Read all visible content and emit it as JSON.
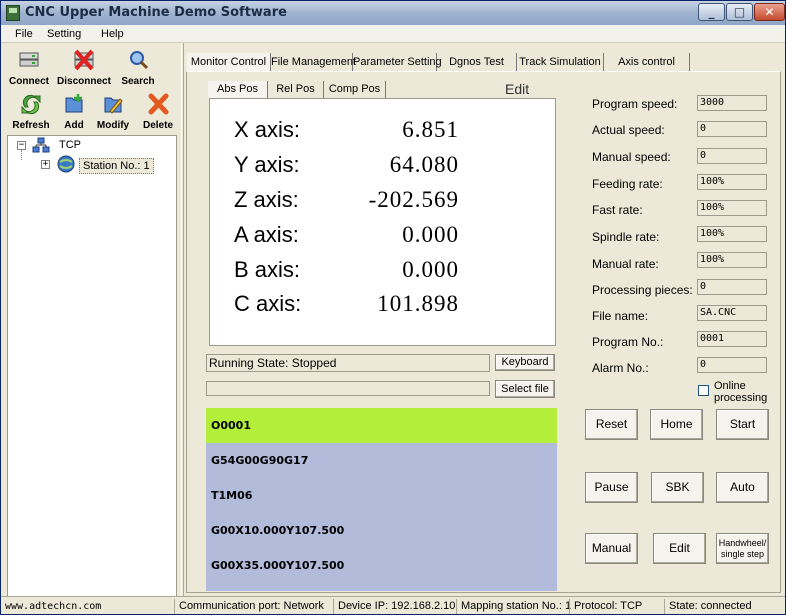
{
  "window": {
    "title": "CNC Upper Machine Demo Software",
    "controls": {
      "minimize": "_",
      "maximize": "□",
      "close": "✕"
    }
  },
  "menu": [
    "File",
    "Setting",
    "Help"
  ],
  "toolbar": {
    "row1": [
      {
        "label": "Connect",
        "icon": "connect-icon"
      },
      {
        "label": "Disconnect",
        "icon": "disconnect-icon"
      },
      {
        "label": "Search",
        "icon": "search-icon"
      }
    ],
    "row2": [
      {
        "label": "Refresh",
        "icon": "refresh-icon"
      },
      {
        "label": "Add",
        "icon": "add-icon"
      },
      {
        "label": "Modify",
        "icon": "modify-icon"
      },
      {
        "label": "Delete",
        "icon": "delete-icon"
      }
    ]
  },
  "tree": {
    "root": "TCP",
    "child": "Station No.: 1"
  },
  "tabs": [
    "Monitor Control",
    "File Management",
    "Parameter Setting",
    "Dgnos Test",
    "Track Simulation",
    "Axis control"
  ],
  "subtabs": [
    "Abs Pos",
    "Rel Pos",
    "Comp Pos"
  ],
  "edit_label": "Edit",
  "axes": [
    {
      "name": "X axis:",
      "value": "6.851"
    },
    {
      "name": "Y axis:",
      "value": "64.080"
    },
    {
      "name": "Z axis:",
      "value": "-202.569"
    },
    {
      "name": "A axis:",
      "value": "0.000"
    },
    {
      "name": "B axis:",
      "value": "0.000"
    },
    {
      "name": "C axis:",
      "value": "101.898"
    }
  ],
  "running_state": "Running State: Stopped",
  "buttons": {
    "keyboard": "Keyboard",
    "select_file": "Select file"
  },
  "program_lines": [
    "O0001",
    "G54G00G90G17",
    "T1M06",
    "G00X10.000Y107.500",
    "G00X35.000Y107.500"
  ],
  "params": [
    {
      "label": "Program speed:",
      "value": "3000"
    },
    {
      "label": "Actual speed:",
      "value": "0"
    },
    {
      "label": "Manual speed:",
      "value": "0"
    },
    {
      "label": "Feeding rate:",
      "value": "100%"
    },
    {
      "label": "Fast rate:",
      "value": "100%"
    },
    {
      "label": "Spindle rate:",
      "value": "100%"
    },
    {
      "label": "Manual rate:",
      "value": "100%"
    },
    {
      "label": "Processing pieces:",
      "value": "0"
    },
    {
      "label": "File name:",
      "value": "SA.CNC"
    },
    {
      "label": "Program No.:",
      "value": "0001"
    },
    {
      "label": "Alarm No.:",
      "value": "0"
    }
  ],
  "online_processing": {
    "label": "Online processing",
    "checked": false
  },
  "action_buttons": [
    "Reset",
    "Home",
    "Start",
    "Pause",
    "SBK",
    "Auto",
    "Manual",
    "Edit",
    "Handwheel/ single step"
  ],
  "status": {
    "url": "www.adtechcn.com",
    "port": "Communication port: Network",
    "ip": "Device IP: 192.168.2.10",
    "mapping": "Mapping station No.: 1",
    "protocol": "Protocol: TCP",
    "state": "State: connected"
  },
  "colors": {
    "current_line": "#b3ef3a",
    "program_bg": "#b2bcda",
    "window_bg": "#ece9d8"
  }
}
